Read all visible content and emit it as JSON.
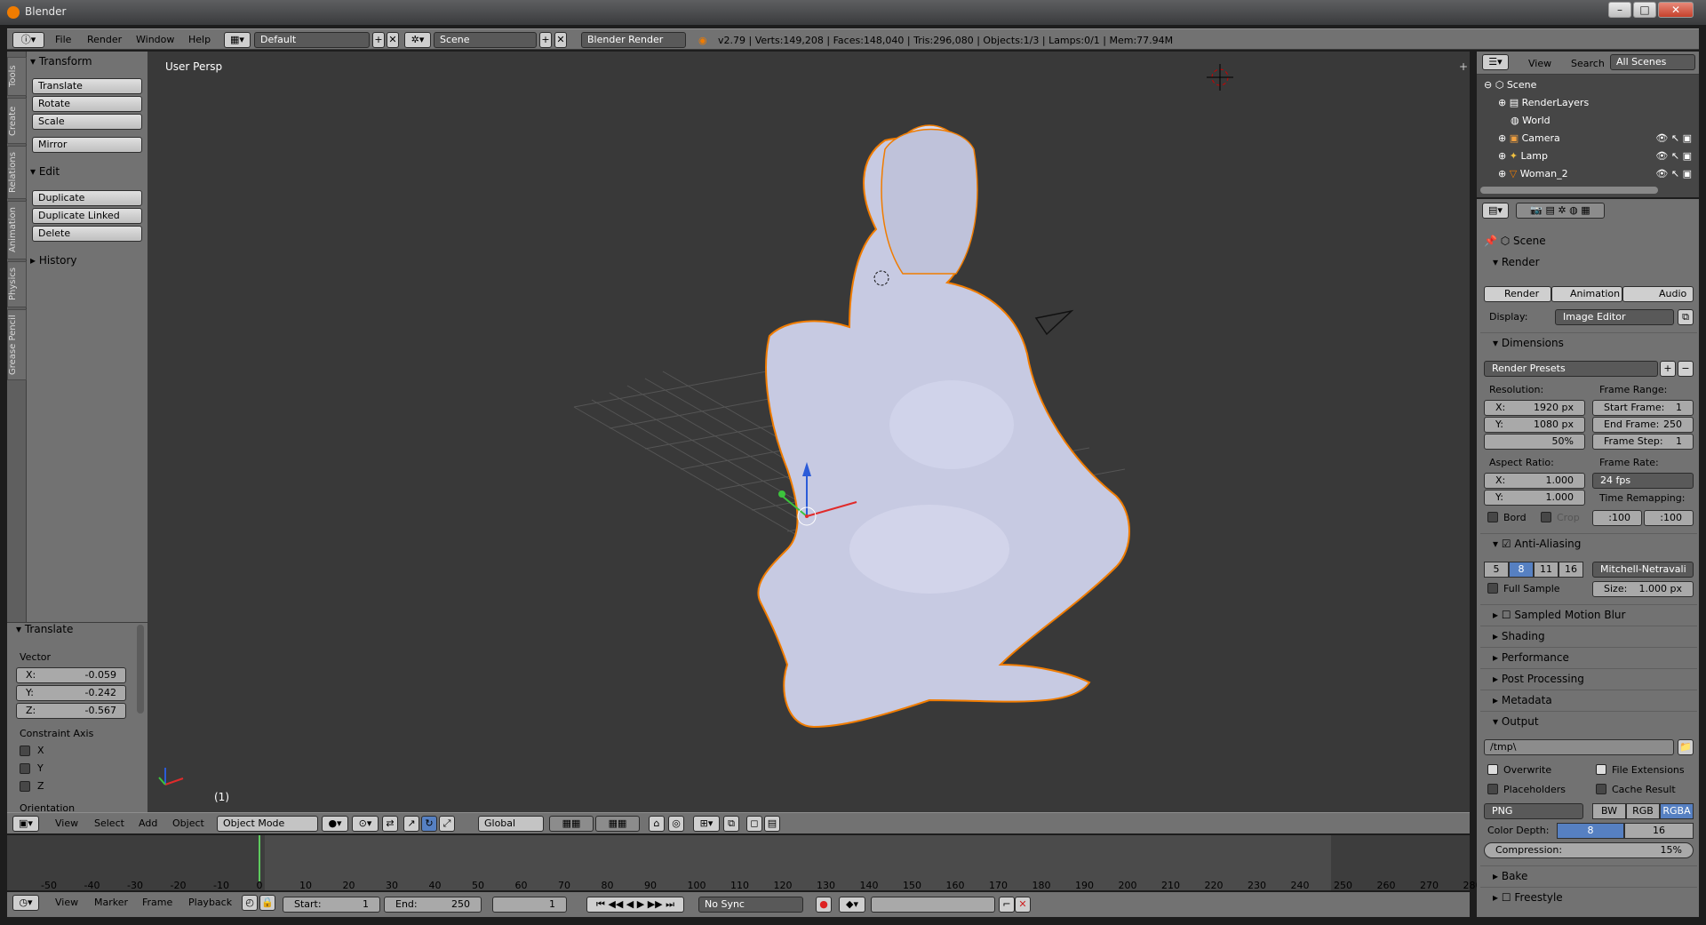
{
  "window": {
    "title": "Blender"
  },
  "menus": {
    "file": "File",
    "render": "Render",
    "window": "Window",
    "help": "Help"
  },
  "screen": {
    "layout": "Default",
    "scene": "Scene",
    "engine": "Blender Render"
  },
  "stats": "v2.79 | Verts:149,208 | Faces:148,040 | Tris:296,080 | Objects:1/3 | Lamps:0/1 | Mem:77.94M",
  "tabs": [
    "Tools",
    "Create",
    "Relations",
    "Animation",
    "Physics",
    "Grease Pencil"
  ],
  "toolshelf": {
    "transform": {
      "title": "Transform",
      "translate": "Translate",
      "rotate": "Rotate",
      "scale": "Scale",
      "mirror": "Mirror"
    },
    "edit": {
      "title": "Edit",
      "duplicate": "Duplicate",
      "duplicate_linked": "Duplicate Linked",
      "delete": "Delete"
    },
    "history": {
      "title": "History"
    }
  },
  "redo": {
    "title": "Translate",
    "vector": "Vector",
    "x": {
      "label": "X:",
      "value": "-0.059"
    },
    "y": {
      "label": "Y:",
      "value": "-0.242"
    },
    "z": {
      "label": "Z:",
      "value": "-0.567"
    },
    "constraint": "Constraint Axis",
    "axes": [
      "X",
      "Y",
      "Z"
    ],
    "orientation": "Orientation"
  },
  "viewport": {
    "label": "User Persp",
    "frame": "(1)"
  },
  "header3d": {
    "view": "View",
    "select": "Select",
    "add": "Add",
    "object": "Object",
    "mode": "Object Mode",
    "orientation": "Global"
  },
  "timeline": {
    "ticks": [
      "-50",
      "-40",
      "-30",
      "-20",
      "-10",
      "0",
      "10",
      "20",
      "30",
      "40",
      "50",
      "60",
      "70",
      "80",
      "90",
      "100",
      "110",
      "120",
      "130",
      "140",
      "150",
      "160",
      "170",
      "180",
      "190",
      "200",
      "210",
      "220",
      "230",
      "240",
      "250",
      "260",
      "270",
      "280"
    ],
    "view": "View",
    "marker": "Marker",
    "frame": "Frame",
    "playback": "Playback",
    "start_label": "Start:",
    "start": "1",
    "end_label": "End:",
    "end": "250",
    "current": "1",
    "sync": "No Sync"
  },
  "outliner": {
    "view": "View",
    "search": "Search",
    "scope": "All Scenes",
    "items": [
      "Scene",
      "RenderLayers",
      "World",
      "Camera",
      "Lamp",
      "Woman_2"
    ]
  },
  "properties": {
    "scene": "Scene",
    "render": {
      "title": "Render",
      "render_btn": "Render",
      "animation_btn": "Animation",
      "audio_btn": "Audio",
      "display_label": "Display:",
      "display": "Image Editor"
    },
    "dimensions": {
      "title": "Dimensions",
      "presets": "Render Presets",
      "resolution": "Resolution:",
      "res_x_label": "X:",
      "res_x": "1920 px",
      "res_y_label": "Y:",
      "res_y": "1080 px",
      "res_pct": "50%",
      "frame_range": "Frame Range:",
      "start_label": "Start Frame:",
      "start": "1",
      "end_label": "End Frame:",
      "end": "250",
      "step_label": "Frame Step:",
      "step": "1",
      "aspect": "Aspect Ratio:",
      "asp_x_label": "X:",
      "asp_x": "1.000",
      "asp_y_label": "Y:",
      "asp_y": "1.000",
      "frame_rate": "Frame Rate:",
      "fps": "24 fps",
      "time_remap": "Time Remapping:",
      "remap_old": ":100",
      "remap_new": ":100",
      "border": "Bord",
      "crop": "Crop"
    },
    "aa": {
      "title": "Anti-Aliasing",
      "samples": [
        "5",
        "8",
        "11",
        "16"
      ],
      "filter": "Mitchell-Netravali",
      "full_sample": "Full Sample",
      "size_label": "Size:",
      "size": "1.000 px"
    },
    "sections": [
      "Sampled Motion Blur",
      "Shading",
      "Performance",
      "Post Processing",
      "Metadata"
    ],
    "output": {
      "title": "Output",
      "path": "/tmp\\",
      "overwrite": "Overwrite",
      "file_ext": "File Extensions",
      "placeholders": "Placeholders",
      "cache": "Cache Result",
      "format": "PNG",
      "bw": "BW",
      "rgb": "RGB",
      "rgba": "RGBA",
      "depth_label": "Color Depth:",
      "depth8": "8",
      "depth16": "16",
      "compression_label": "Compression:",
      "compression": "15%"
    },
    "bake": "Bake",
    "freestyle": "Freestyle"
  },
  "colors": {
    "accent": "#5680c2",
    "selection_outline": "#f07c00"
  }
}
